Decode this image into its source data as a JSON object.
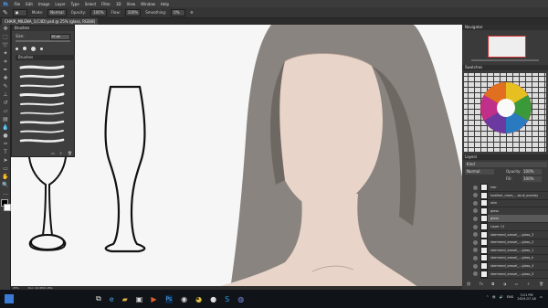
{
  "menu": [
    "File",
    "Edit",
    "Image",
    "Layer",
    "Type",
    "Select",
    "Filter",
    "3D",
    "View",
    "Window",
    "Help"
  ],
  "options": {
    "mode_label": "Mode:",
    "mode_value": "Normal",
    "opacity_label": "Opacity:",
    "opacity_value": "100%",
    "flow_label": "Flow:",
    "flow_value": "100%",
    "smoothing_label": "Smoothing:",
    "smoothing_value": "0%"
  },
  "document": {
    "tab_title": "CHAIR_MILENA_1(C4D).psd @ 25% (glass, RGB/8)"
  },
  "brush_panel": {
    "title": "Brushes",
    "size_label": "Size:",
    "size_value": "20 px",
    "group_label": "Brushes"
  },
  "navigator": {
    "title": "Navigator"
  },
  "swatches": {
    "title": "Swatches"
  },
  "layers": {
    "title": "Layers",
    "kind_label": "Kind",
    "blend_mode": "Normal",
    "opacity_label": "Opacity:",
    "opacity_value": "100%",
    "fill_label": "Fill:",
    "fill_value": "100%",
    "items": [
      {
        "name": "hair",
        "selected": false
      },
      {
        "name": "heather_more_...skull_overlay",
        "selected": false
      },
      {
        "name": "skin",
        "selected": false
      },
      {
        "name": "glass",
        "selected": false
      },
      {
        "name": "glass",
        "selected": true
      },
      {
        "name": "Layer 11",
        "selected": false
      },
      {
        "name": "stemmed_vessel_...glass_3",
        "selected": false
      },
      {
        "name": "stemmed_vessel_...glass_2",
        "selected": false
      },
      {
        "name": "stemmed_vessel_...glass_1",
        "selected": false
      },
      {
        "name": "stemmed_vessel_...glass_h",
        "selected": false
      },
      {
        "name": "stemmed_vessel_...glass_4",
        "selected": false
      },
      {
        "name": "stemmed_vessel_...glass_5",
        "selected": false
      }
    ]
  },
  "status": {
    "zoom": "25%",
    "doc_size": "Doc: 24.9M/1.05G"
  },
  "taskbar": {
    "time": "3:21 PM",
    "date": "2019-07-18",
    "lang": "ENG"
  },
  "colors": {
    "hair": "#7a746f",
    "skin": "#e8d4c8",
    "canvas": "#f6f6f6",
    "layer_selected": "#5a5a5a"
  }
}
